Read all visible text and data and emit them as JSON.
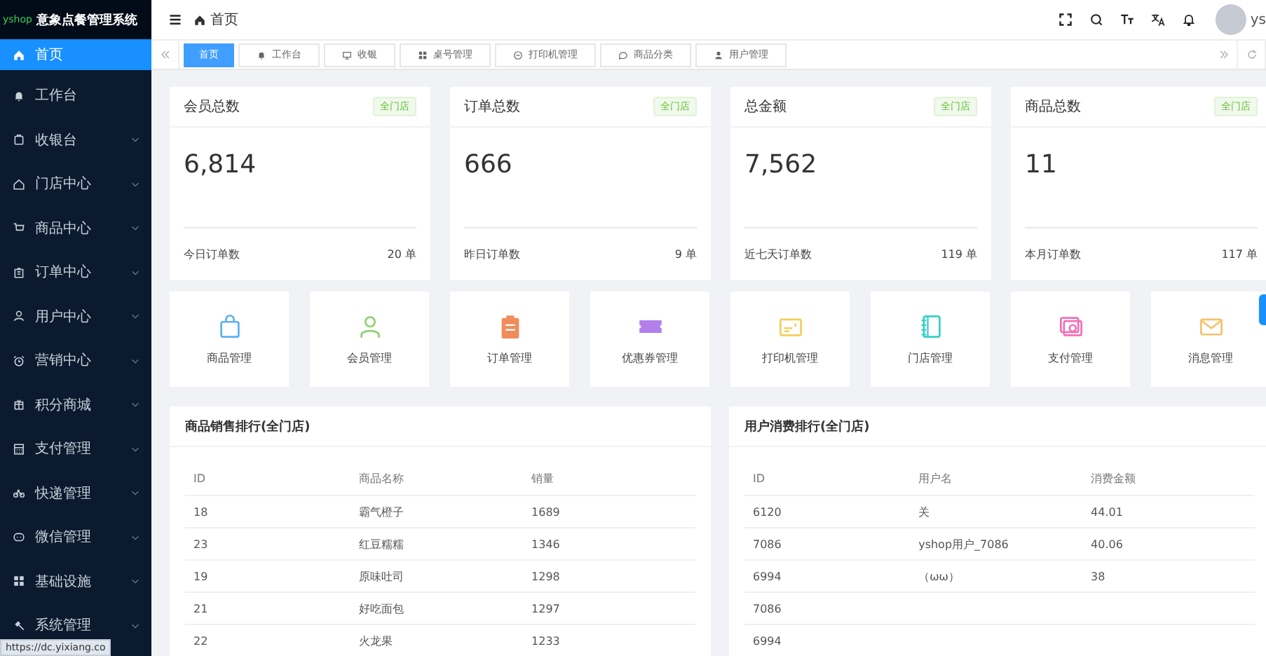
{
  "app": {
    "logo": "yshop",
    "title": "意象点餐管理系统"
  },
  "sidebar": {
    "items": [
      {
        "label": "首页",
        "selected": true,
        "expandable": false
      },
      {
        "label": "工作台",
        "selected": false,
        "expandable": false
      },
      {
        "label": "收银台",
        "selected": false,
        "expandable": true
      },
      {
        "label": "门店中心",
        "selected": false,
        "expandable": true
      },
      {
        "label": "商品中心",
        "selected": false,
        "expandable": true
      },
      {
        "label": "订单中心",
        "selected": false,
        "expandable": true
      },
      {
        "label": "用户中心",
        "selected": false,
        "expandable": true
      },
      {
        "label": "营销中心",
        "selected": false,
        "expandable": true
      },
      {
        "label": "积分商城",
        "selected": false,
        "expandable": true
      },
      {
        "label": "支付管理",
        "selected": false,
        "expandable": true
      },
      {
        "label": "快递管理",
        "selected": false,
        "expandable": true
      },
      {
        "label": "微信管理",
        "selected": false,
        "expandable": true
      },
      {
        "label": "基础设施",
        "selected": false,
        "expandable": true
      },
      {
        "label": "系统管理",
        "selected": false,
        "expandable": true
      }
    ]
  },
  "breadcrumb": "首页",
  "user": {
    "name": "ys"
  },
  "tabs": [
    {
      "label": "首页",
      "selected": true
    },
    {
      "label": "工作台",
      "selected": false
    },
    {
      "label": "收银",
      "selected": false
    },
    {
      "label": "桌号管理",
      "selected": false
    },
    {
      "label": "打印机管理",
      "selected": false
    },
    {
      "label": "商品分类",
      "selected": false
    },
    {
      "label": "用户管理",
      "selected": false
    }
  ],
  "stats": [
    {
      "title": "会员总数",
      "tag": "全门店",
      "value": "6,814",
      "footer_label": "今日订单数",
      "footer_value": "20 单"
    },
    {
      "title": "订单总数",
      "tag": "全门店",
      "value": "666",
      "footer_label": "昨日订单数",
      "footer_value": "9 单"
    },
    {
      "title": "总金额",
      "tag": "全门店",
      "value": "7,562",
      "footer_label": "近七天订单数",
      "footer_value": "119 单"
    },
    {
      "title": "商品总数",
      "tag": "全门店",
      "value": "11",
      "footer_label": "本月订单数",
      "footer_value": "117 单"
    }
  ],
  "shortcuts": [
    {
      "label": "商品管理",
      "color": "#5ab1ef"
    },
    {
      "label": "会员管理",
      "color": "#8fd16f"
    },
    {
      "label": "订单管理",
      "color": "#f08c5a"
    },
    {
      "label": "优惠券管理",
      "color": "#b37feb"
    },
    {
      "label": "打印机管理",
      "color": "#f5cd5a"
    },
    {
      "label": "门店管理",
      "color": "#36cfc9"
    },
    {
      "label": "支付管理",
      "color": "#f16fb8"
    },
    {
      "label": "消息管理",
      "color": "#f5c36a"
    }
  ],
  "tables": [
    {
      "title": "商品销售排行(全门店)",
      "columns": [
        "ID",
        "商品名称",
        "销量"
      ],
      "rows": [
        [
          "18",
          "霸气橙子",
          "1689"
        ],
        [
          "23",
          "红豆糯糯",
          "1346"
        ],
        [
          "19",
          "原味吐司",
          "1298"
        ],
        [
          "21",
          "好吃面包",
          "1297"
        ],
        [
          "22",
          "火龙果",
          "1233"
        ]
      ]
    },
    {
      "title": "用户消费排行(全门店)",
      "columns": [
        "ID",
        "用户名",
        "消费金额"
      ],
      "rows": [
        [
          "6120",
          "关",
          "44.01"
        ],
        [
          "7086",
          "yshop用户_7086",
          "40.06"
        ],
        [
          "6994",
          "（ωω）",
          "38"
        ],
        [
          "7086"
        ],
        [
          "6994"
        ]
      ]
    }
  ],
  "status_url": "https://dc.yixiang.co"
}
